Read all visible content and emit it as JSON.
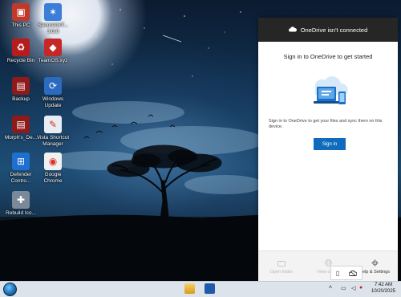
{
  "desktop": {
    "icons": [
      {
        "label": "This PC",
        "color": "#c0392b",
        "glyph": "▣",
        "icon_name": "this-pc-icon"
      },
      {
        "label": "SecureUxT...\n3.0.0",
        "color": "#3b7dd8",
        "glyph": "✶",
        "icon_name": "secureux-icon"
      },
      {
        "label": "Recycle Bin",
        "color": "#b71c1c",
        "glyph": "♻",
        "icon_name": "recycle-bin-icon"
      },
      {
        "label": "TeamOS.xyz",
        "color": "#c62828",
        "glyph": "◆",
        "icon_name": "teamos-icon"
      },
      {
        "label": "Backup",
        "color": "#8e1a1a",
        "glyph": "▤",
        "icon_name": "backup-icon"
      },
      {
        "label": "Windows\nUpdate",
        "color": "#2a6bc0",
        "glyph": "⟳",
        "icon_name": "windows-update-icon"
      },
      {
        "label": "Morph's_De...",
        "color": "#8e1a1a",
        "glyph": "▤",
        "icon_name": "morphs-desktop-icon"
      },
      {
        "label": "Vista Shortcut\nManager",
        "color": "#e8edf3",
        "glyph": "✎",
        "icon_name": "vista-shortcut-manager-icon"
      },
      {
        "label": "Defender\nContro...",
        "color": "#1f6fd1",
        "glyph": "⊞",
        "icon_name": "defender-control-icon"
      },
      {
        "label": "Google\nChrome",
        "color": "#f1f1f1",
        "glyph": "◉",
        "icon_name": "google-chrome-icon"
      },
      {
        "label": "Rebuild Ico...",
        "color": "#7b8a99",
        "glyph": "✚",
        "icon_name": "rebuild-icons-icon"
      }
    ]
  },
  "onedrive": {
    "header_title": "OneDrive isn't connected",
    "heading": "Sign in to OneDrive to get started",
    "description": "Sign in to OneDrive to get your files and sync them on this device.",
    "signin_label": "Sign in",
    "footer": {
      "open_folder": "Open folder",
      "view_online": "View online",
      "help_settings": "Help & Settings"
    }
  },
  "taskbar": {
    "time": "7:42 AM",
    "date": "10/20/2025"
  },
  "colors": {
    "accent": "#0f6cbd",
    "header_bg": "#262626",
    "taskbar_bg": "#dde3ea"
  }
}
